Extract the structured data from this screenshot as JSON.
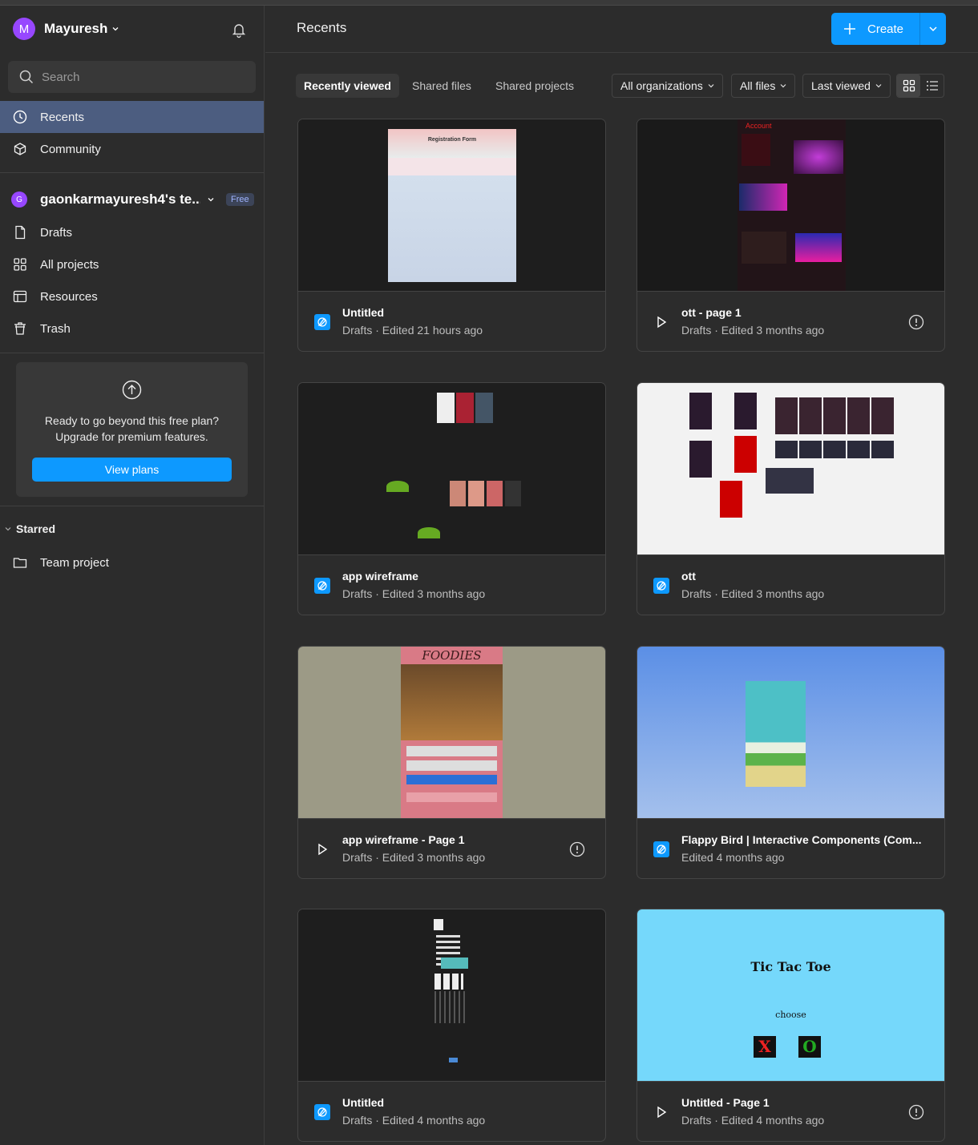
{
  "user": {
    "name": "Mayuresh",
    "initial": "M"
  },
  "search": {
    "placeholder": "Search"
  },
  "nav": {
    "recents": "Recents",
    "community": "Community"
  },
  "team": {
    "initial": "G",
    "name": "gaonkarmayuresh4's te...",
    "badge": "Free"
  },
  "team_nav": {
    "drafts": "Drafts",
    "all_projects": "All projects",
    "resources": "Resources",
    "trash": "Trash"
  },
  "upgrade": {
    "line1": "Ready to go beyond this free plan?",
    "line2": "Upgrade for premium features.",
    "button": "View plans"
  },
  "starred": {
    "title": "Starred",
    "items": [
      "Team project"
    ]
  },
  "header": {
    "title": "Recents",
    "create": "Create"
  },
  "tabs": [
    "Recently viewed",
    "Shared files",
    "Shared projects"
  ],
  "filters": {
    "org": "All organizations",
    "files": "All files",
    "sort": "Last viewed"
  },
  "colors": {
    "accent": "#0d99ff",
    "active_nav": "#4c5d80",
    "team_avatar": "#9747ff"
  },
  "files": [
    {
      "name": "Untitled",
      "sub": "Drafts · Edited 21 hours ago",
      "icon": "design-file-icon",
      "info": false,
      "thumb_text": "Registration Form"
    },
    {
      "name": "ott - page 1",
      "sub": "Drafts · Edited 3 months ago",
      "icon": "prototype-play-icon",
      "info": true,
      "thumb_text": "Account"
    },
    {
      "name": "app wireframe",
      "sub": "Drafts · Edited 3 months ago",
      "icon": "design-file-icon",
      "info": false
    },
    {
      "name": "ott",
      "sub": "Drafts · Edited 3 months ago",
      "icon": "design-file-icon",
      "info": false
    },
    {
      "name": "app wireframe - Page 1",
      "sub": "Drafts · Edited 3 months ago",
      "icon": "prototype-play-icon",
      "info": true,
      "thumb_text": "FOODIES"
    },
    {
      "name": "Flappy Bird | Interactive Components (Com...",
      "sub": "Edited 4 months ago",
      "icon": "design-file-icon",
      "info": false
    },
    {
      "name": "Untitled",
      "sub": "Drafts · Edited 4 months ago",
      "icon": "design-file-icon",
      "info": false
    },
    {
      "name": "Untitled - Page 1",
      "sub": "Drafts · Edited 4 months ago",
      "icon": "prototype-play-icon",
      "info": true,
      "thumb_text": "Tic Tac Toe",
      "thumb_sub": "choose",
      "x": "X",
      "o": "O"
    }
  ]
}
